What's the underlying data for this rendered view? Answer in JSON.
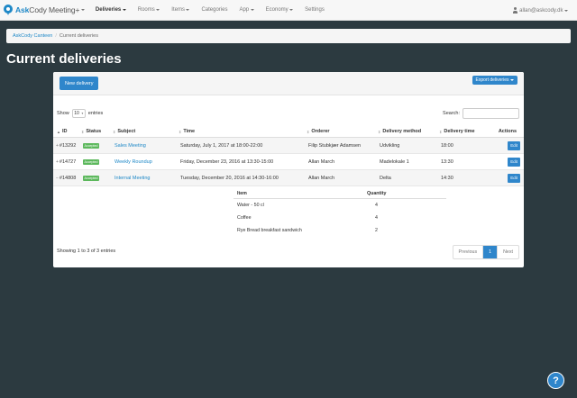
{
  "brand": {
    "name_bold": "Ask",
    "name_rest": "Cody Meeting+"
  },
  "nav": [
    {
      "label": "Deliveries",
      "active": true
    },
    {
      "label": "Rooms"
    },
    {
      "label": "Items"
    },
    {
      "label": "Categories"
    },
    {
      "label": "App"
    },
    {
      "label": "Economy"
    },
    {
      "label": "Settings"
    }
  ],
  "user": {
    "email": "allan@askcody.dk"
  },
  "breadcrumb": {
    "root": "AskCody Canteen",
    "separator": "/",
    "current": "Current deliveries"
  },
  "page_title": "Current deliveries",
  "panel": {
    "new_button": "New delivery",
    "export_button": "Export deliveries"
  },
  "controls": {
    "show_prefix": "Show",
    "page_size": "10",
    "show_suffix": "entries",
    "search_label": "Search:",
    "search_value": ""
  },
  "table": {
    "headers": {
      "id": "ID",
      "status": "Status",
      "subject": "Subject",
      "time": "Time",
      "orderer": "Orderer",
      "method": "Delivery method",
      "dtime": "Delivery time",
      "actions": "Actions"
    },
    "rows": [
      {
        "id": "#13292",
        "status": "Accepted",
        "subject": "Sales Meeting",
        "time": "Saturday, July 1, 2017 at 18:00-22:00",
        "orderer": "Filip Stubkjær Adamsen",
        "method": "Udvikling",
        "dtime": "18:00",
        "action": "Edit"
      },
      {
        "id": "#14727",
        "status": "Accepted",
        "subject": "Weekly Roundup",
        "time": "Friday, December 23, 2016 at 13:30-15:00",
        "orderer": "Allan March",
        "method": "Madelokale 1",
        "dtime": "13:30",
        "action": "Edit"
      },
      {
        "id": "#14808",
        "status": "Accepted",
        "subject": "Internal Meeting",
        "time": "Tuesday, December 20, 2016 at 14:30-16:00",
        "orderer": "Allan March",
        "method": "Delta",
        "dtime": "14:30",
        "action": "Edit"
      }
    ]
  },
  "subtable": {
    "headers": {
      "item": "Item",
      "quantity": "Quantity"
    },
    "rows": [
      {
        "item": "Water - 50 cl",
        "quantity": "4"
      },
      {
        "item": "Coffee",
        "quantity": "4"
      },
      {
        "item": "Rye Bread breakfast sandwich",
        "quantity": "2"
      }
    ]
  },
  "footer": {
    "info": "Showing 1 to 3 of 3 entries",
    "prev": "Previous",
    "page": "1",
    "next": "Next"
  },
  "help": {
    "label": "?"
  },
  "colors": {
    "accent": "#2f86cb",
    "background": "#2c3a40",
    "success": "#5cb85c"
  }
}
